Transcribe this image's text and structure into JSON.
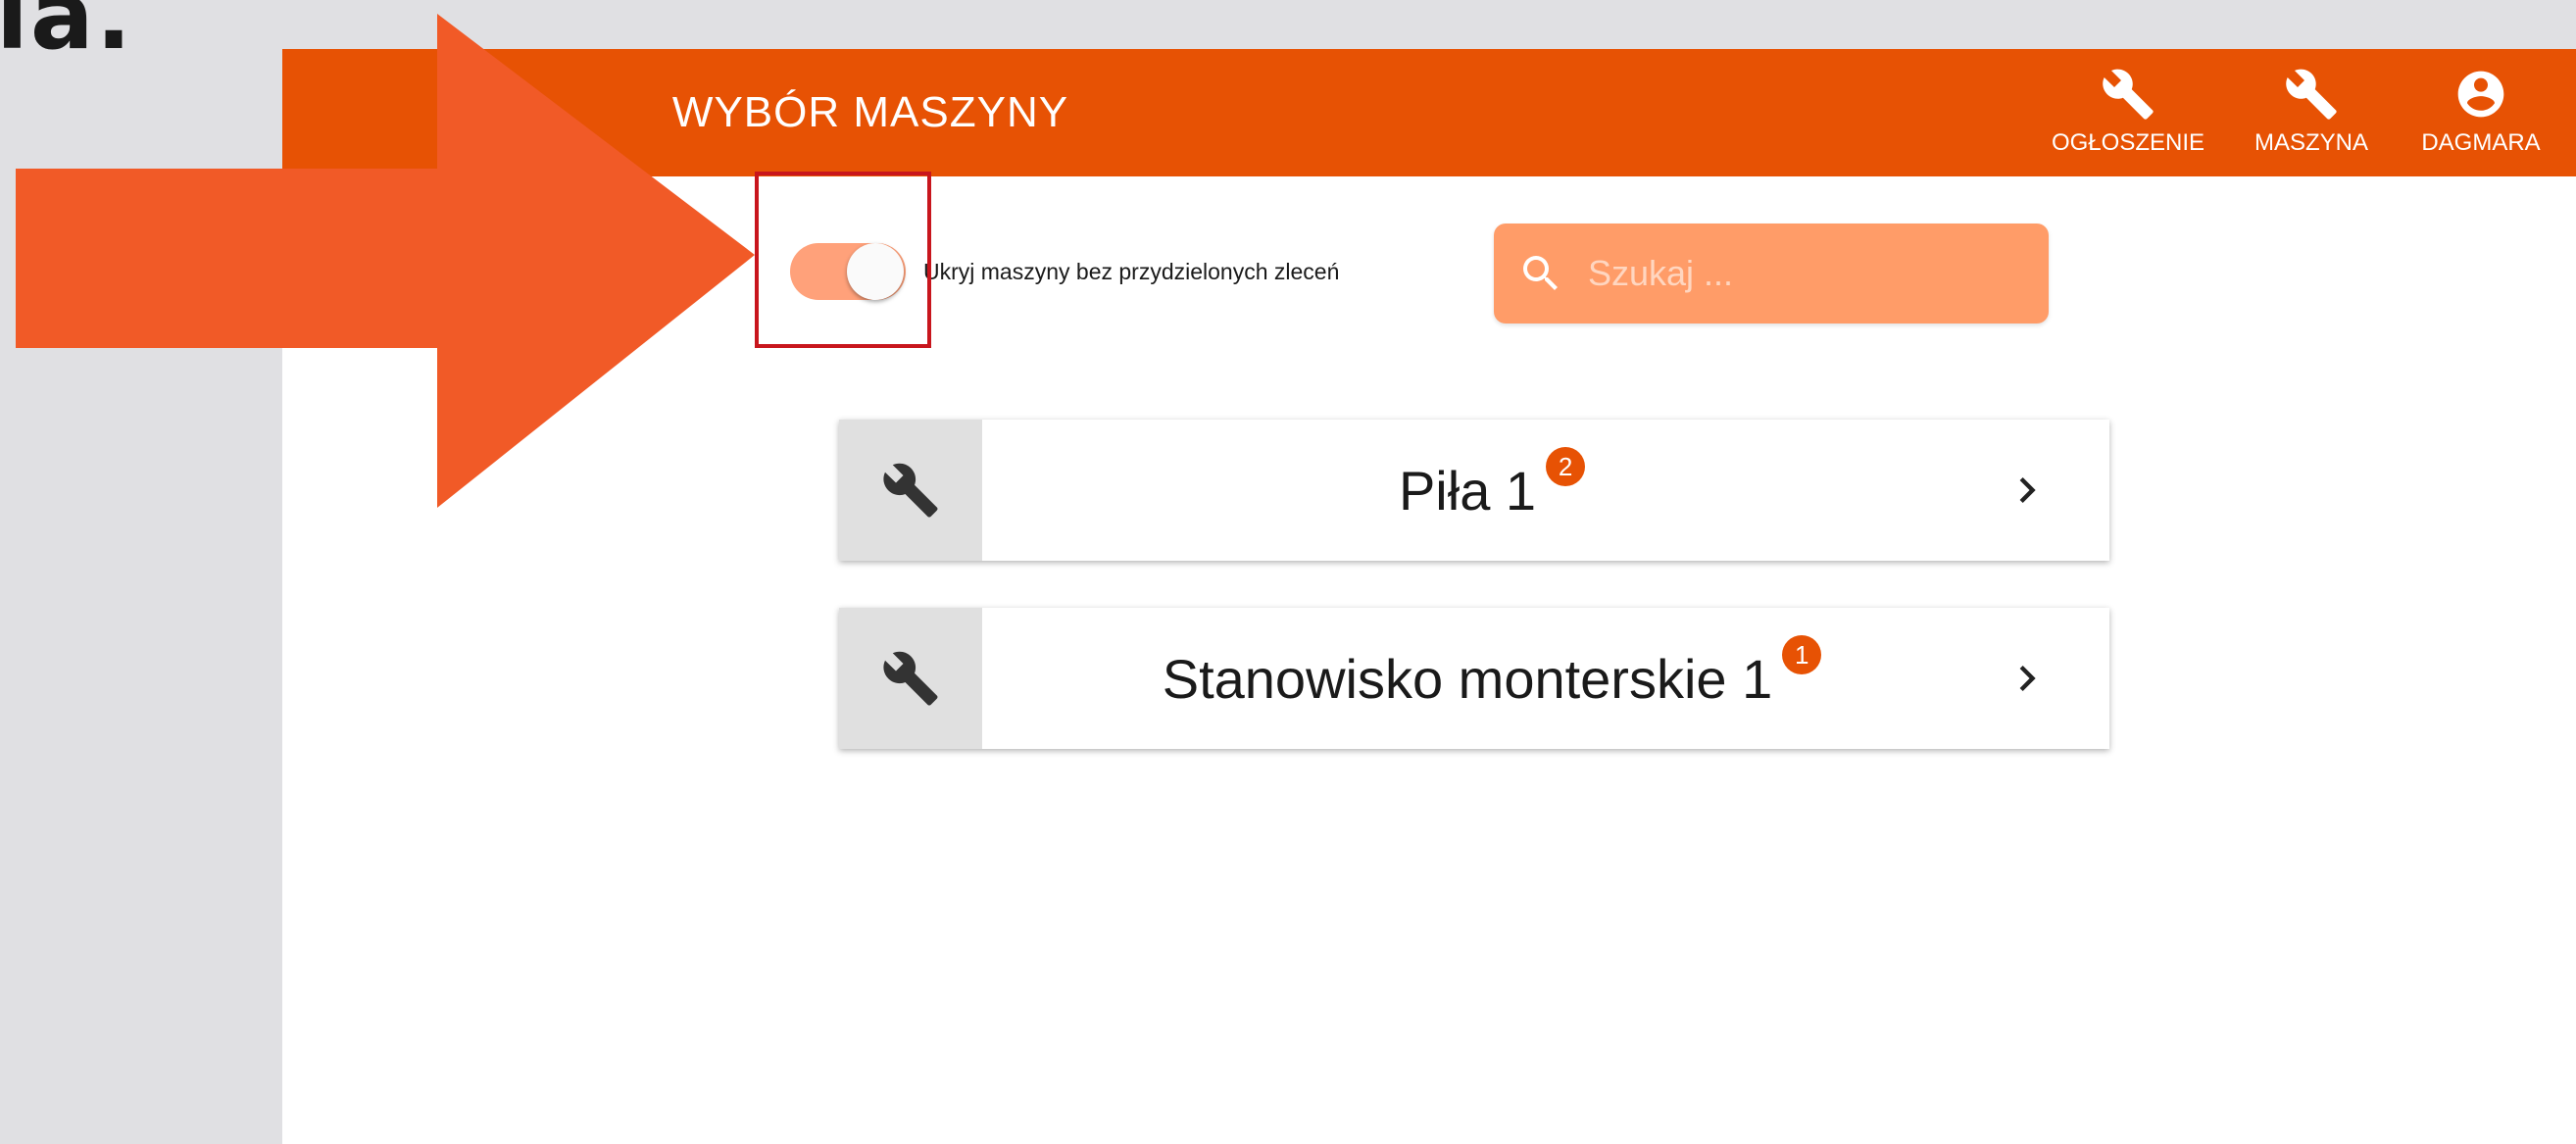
{
  "background_text": "ia.",
  "topbar": {
    "title": "WYBÓR MASZYNY",
    "actions": [
      {
        "label": "OGŁOSZENIE",
        "icon": "wrench-icon"
      },
      {
        "label": "MASZYNA",
        "icon": "wrench-icon"
      },
      {
        "label": "DAGMARA",
        "icon": "account-circle-icon"
      }
    ]
  },
  "filter": {
    "toggle_label": "Ukryj maszyny bez przydzielonych zleceń",
    "toggle_on": true
  },
  "search": {
    "placeholder": "Szukaj ..."
  },
  "machines": [
    {
      "name": "Piła 1",
      "badge": "2"
    },
    {
      "name": "Stanowisko monterskie 1",
      "badge": "1"
    }
  ],
  "colors": {
    "primary": "#e75204",
    "primary_light": "#ffa17a",
    "search_bg": "#ff9c68",
    "annotation_arrow": "#f15a27",
    "annotation_box": "#c8161d"
  }
}
